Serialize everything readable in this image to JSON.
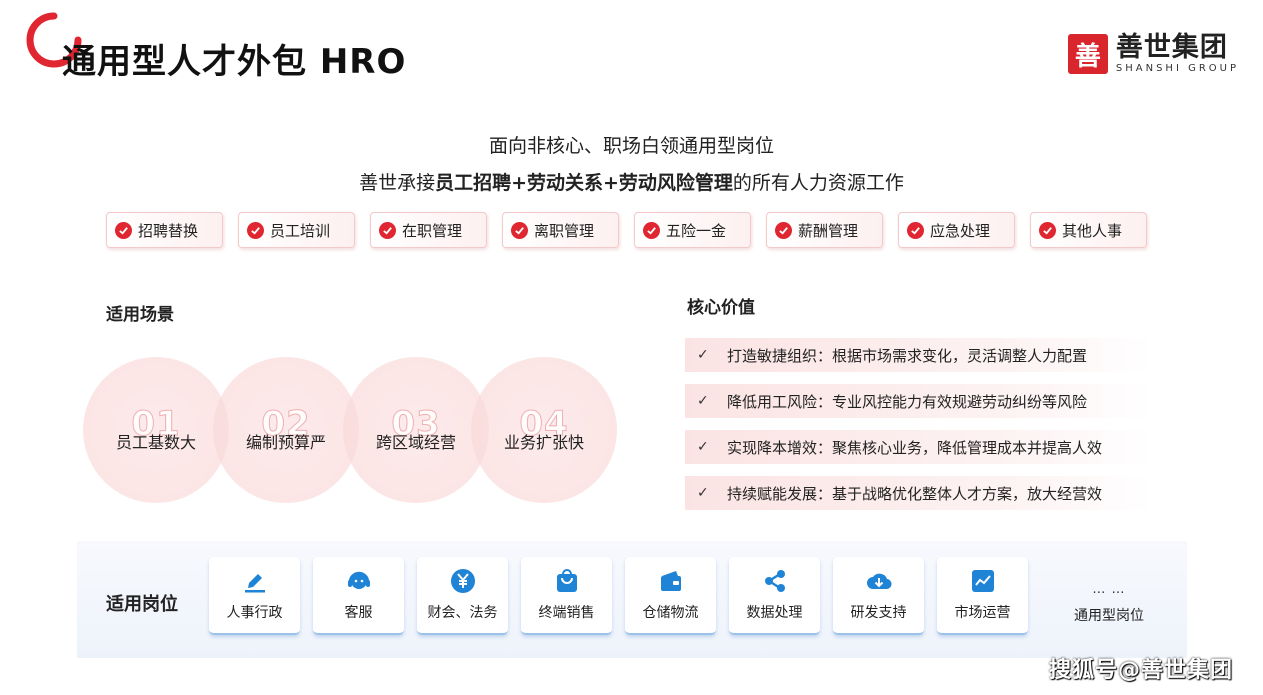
{
  "header": {
    "title": "通用型人才外包 HRO",
    "brand_name": "善世集团",
    "brand_sub": "SHANSHI GROUP",
    "brand_mark_char": "善"
  },
  "intro": {
    "line1": "面向非核心、职场白领通用型岗位",
    "line2_pre": "善世承接",
    "line2_bold": "员工招聘+劳动关系+劳动风险管理",
    "line2_post": "的所有人力资源工作"
  },
  "tags": [
    "招聘替换",
    "员工培训",
    "在职管理",
    "离职管理",
    "五险一金",
    "薪酬管理",
    "应急处理",
    "其他人事"
  ],
  "scenarios": {
    "label": "适用场景",
    "items": [
      {
        "num": "01",
        "label": "员工基数大"
      },
      {
        "num": "02",
        "label": "编制预算严"
      },
      {
        "num": "03",
        "label": "跨区域经营"
      },
      {
        "num": "04",
        "label": "业务扩张快"
      }
    ]
  },
  "core_values": {
    "label": "核心价值",
    "items": [
      "打造敏捷组织：根据市场需求变化，灵活调整人力配置",
      "降低用工风险：专业风控能力有效规避劳动纠纷等风险",
      "实现降本增效：聚焦核心业务，降低管理成本并提高人效",
      "持续赋能发展：基于战略优化整体人才方案，放大经营效"
    ]
  },
  "positions": {
    "label": "适用岗位",
    "items": [
      {
        "label": "人事行政",
        "icon": "pen-icon"
      },
      {
        "label": "客服",
        "icon": "headset-icon"
      },
      {
        "label": "财会、法务",
        "icon": "yuan-icon"
      },
      {
        "label": "终端销售",
        "icon": "shopping-bag-icon"
      },
      {
        "label": "仓储物流",
        "icon": "wallet-icon"
      },
      {
        "label": "数据处理",
        "icon": "share-icon"
      },
      {
        "label": "研发支持",
        "icon": "cloud-download-icon"
      },
      {
        "label": "市场运营",
        "icon": "chart-line-icon"
      }
    ],
    "more_dots": "… …",
    "more_label": "通用型岗位"
  },
  "watermark": "搜狐号@善世集团",
  "colors": {
    "accent_red": "#e02630",
    "brand_red": "#d9262c",
    "icon_blue": "#1f84d6"
  }
}
